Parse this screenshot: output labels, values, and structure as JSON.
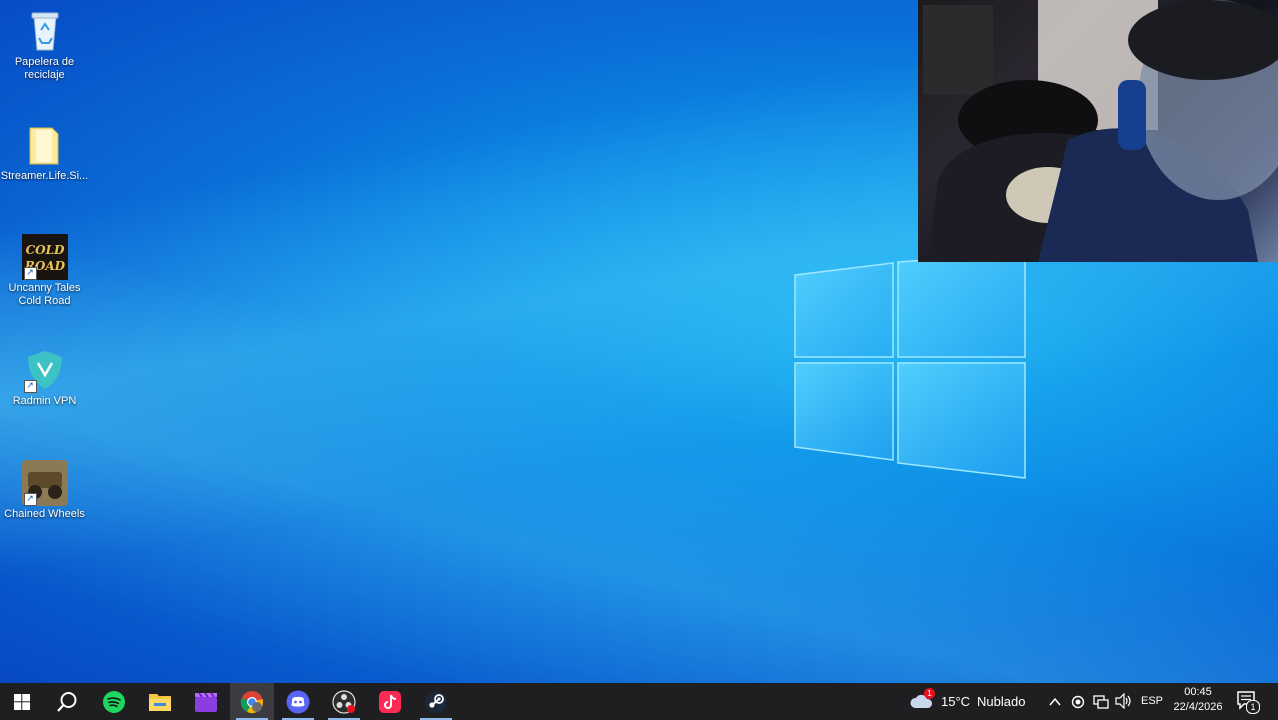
{
  "desktop_icons": [
    {
      "label": "Papelera de reciclaje",
      "icon": "recycle-bin-icon"
    },
    {
      "label": "Streamer.Life.Si...",
      "icon": "folder-icon"
    },
    {
      "label": "Uncanny Tales Cold Road",
      "icon": "game-cold-road-icon",
      "logo_text": "COLD ROAD"
    },
    {
      "label": "Radmin VPN",
      "icon": "radmin-vpn-icon"
    },
    {
      "label": "Chained Wheels",
      "icon": "chained-wheels-icon"
    }
  ],
  "taskbar": {
    "apps": [
      "start",
      "search",
      "spotify",
      "file-explorer",
      "video-editor",
      "chrome",
      "discord",
      "obs",
      "tiktok",
      "steam"
    ],
    "weather": {
      "temp": "15°C",
      "condition": "Nublado",
      "badge": "1"
    },
    "language": "ESP",
    "time": "00:45",
    "date": "22/4/2026",
    "notification_count": "1"
  },
  "colors": {
    "taskbar": "#1f1f22",
    "accent": "#8fb9ec"
  }
}
